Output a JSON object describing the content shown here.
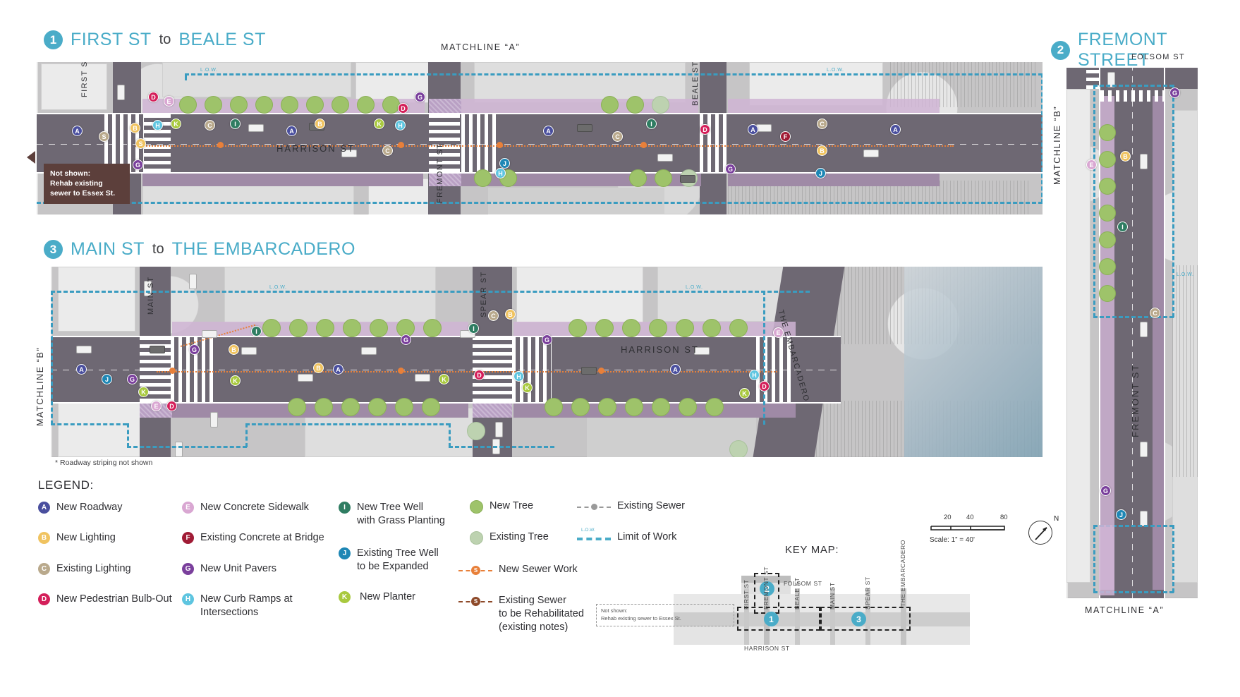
{
  "sections": [
    {
      "num": "1",
      "title_a": "FIRST ST",
      "to": "to",
      "title_b": "BEALE ST"
    },
    {
      "num": "2",
      "title_full": "FREMONT STREET"
    },
    {
      "num": "3",
      "title_a": "MAIN ST",
      "to": "to",
      "title_b": "THE EMBARCADERO"
    }
  ],
  "matchlines": {
    "a_top": "MATCHLINE “A”",
    "b_right": "MATCHLINE “B”",
    "b_left": "MATCHLINE “B”",
    "a_bottom": "MATCHLINE “A”"
  },
  "street_labels": {
    "panel1": [
      "FIRST ST",
      "HARRISON ST",
      "FREMONT ST",
      "BEALE ST"
    ],
    "panel2": [
      "FOLSOM ST",
      "FREMONT ST"
    ],
    "panel3": [
      "MAIN ST",
      "SPEAR ST",
      "HARRISON ST",
      "THE EMBARCADERO"
    ]
  },
  "callout": {
    "line1": "Not shown:",
    "line2": "Rehab existing",
    "line3": "sewer to Essex St."
  },
  "footnote": "* Roadway striping not shown",
  "legend": {
    "title": "LEGEND:",
    "col1": [
      {
        "key": "A",
        "label": "New Roadway",
        "color": "#4a4f9e"
      },
      {
        "key": "B",
        "label": "New Lighting",
        "color": "#f0c360"
      },
      {
        "key": "C",
        "label": "Existing Lighting",
        "color": "#b9a98c"
      },
      {
        "key": "D",
        "label": "New Pedestrian Bulb-Out",
        "color": "#d41f5a"
      }
    ],
    "col2": [
      {
        "key": "E",
        "label": "New Concrete Sidewalk",
        "color": "#d9a7d2"
      },
      {
        "key": "F",
        "label": "Existing Concrete at Bridge",
        "color": "#a01b35"
      },
      {
        "key": "G",
        "label": "New Unit Pavers",
        "color": "#7a3f9c"
      },
      {
        "key": "H",
        "label": "New Curb Ramps at\nIntersections",
        "color": "#5ec5e0"
      }
    ],
    "col3": [
      {
        "key": "I",
        "label": "New Tree Well\nwith Grass Planting",
        "color": "#2f7d62"
      },
      {
        "key": "J",
        "label": "Existing Tree Well\nto be Expanded",
        "color": "#1e87b5"
      },
      {
        "key": "K",
        "label": "New Planter",
        "color": "#a9c93f"
      }
    ],
    "col4": [
      {
        "kind": "tree-new",
        "label": "New Tree",
        "color": "#9ec36a"
      },
      {
        "kind": "tree-existing",
        "label": "Existing Tree",
        "color": "#bdd2b0"
      },
      {
        "kind": "line-sewer-new",
        "label": "New Sewer Work",
        "color": "#e8803a",
        "dot_key": "S"
      },
      {
        "kind": "line-sewer-rehab",
        "label": "Existing Sewer\nto be Rehabilitated\n(existing notes)",
        "color": "#8e4a2a",
        "dot_key": "S"
      }
    ],
    "col5": [
      {
        "kind": "line-existing-sewer",
        "label": "Existing Sewer",
        "color": "#9a9a9a"
      },
      {
        "kind": "line-limit-of-work",
        "label": "Limit of Work",
        "color": "#4aacc8",
        "tag": "L.O.W."
      }
    ]
  },
  "keymap": {
    "title": "KEY MAP:",
    "streets": [
      "FIRST ST",
      "FREMONT ST",
      "FOLSOM ST",
      "BEALE ST",
      "MAIN ST",
      "SPEAR ST",
      "THE EMBARCADERO",
      "HARRISON ST"
    ],
    "markers": [
      "1",
      "2",
      "3"
    ],
    "note_line1": "Not shown:",
    "note_line2": "Rehab existing sewer to Essex St."
  },
  "scale": {
    "ticks": [
      "20",
      "40",
      "80"
    ],
    "caption": "Scale: 1” = 40'",
    "north": "N"
  },
  "colors": {
    "accent_teal": "#4aacc8",
    "roadway": "#6e6873",
    "sidewalk": "#cfb4d4",
    "tree_new": "#9ec36a",
    "tree_existing": "#bdd2b0",
    "sewer_new": "#e8803a",
    "sewer_rehab": "#8e4a2a",
    "limit_of_work": "#3a9cc0",
    "callout_bg": "#5c3f3b"
  }
}
